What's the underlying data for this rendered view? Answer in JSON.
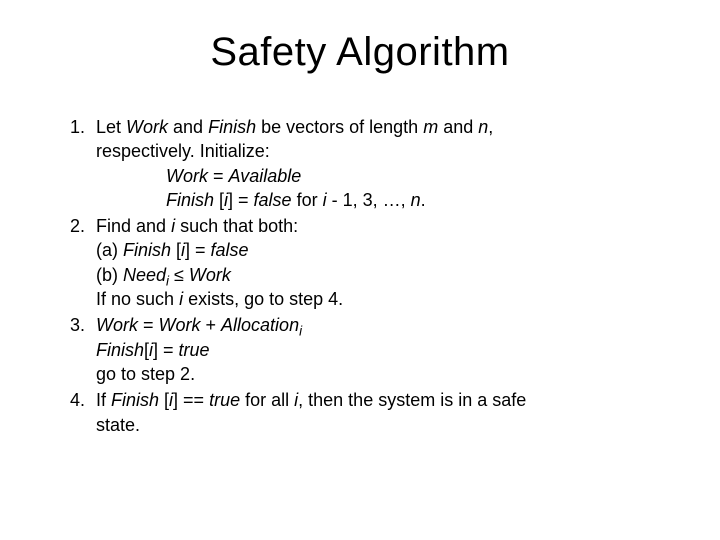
{
  "title": "Safety Algorithm",
  "s1": {
    "num": "1.",
    "l1a": "Let ",
    "work": "Work",
    "l1b": " and ",
    "finish": "Finish",
    "l1c": " be vectors of length ",
    "m": "m",
    "l1d": " and ",
    "n": "n",
    "l1e": ",",
    "l2": "respectively.  Initialize:",
    "l3a": "Work",
    "l3b": " = ",
    "l3c": "Available",
    "l4a": "Finish ",
    "l4b": "[",
    "l4i": "i",
    "l4c": "] = ",
    "l4false": "false",
    "l4d": " for ",
    "l4i2": "i ",
    "l4e": "- 1, 3, …, ",
    "l4n": "n",
    "l4f": "."
  },
  "s2": {
    "num": "2.",
    "l1a": "Find and ",
    "l1i": "i",
    "l1b": " such that both:",
    "l2a": "(a) ",
    "l2fin": "Finish ",
    "l2b": "[",
    "l2i": "i",
    "l2c": "] = ",
    "l2false": "false",
    "l3a": "(b) ",
    "l3need": "Need",
    "l3sub": "i",
    "l3b": " ≤ ",
    "l3work": "Work",
    "l4a": "If no such ",
    "l4i": "i",
    "l4b": " exists, go to step 4."
  },
  "s3": {
    "num": "3.",
    "l1a": "Work",
    "l1b": " = ",
    "l1c": "Work",
    "l1d": " + ",
    "l1e": "Allocation",
    "l1sub": "i",
    "l2a": "Finish",
    "l2b": "[",
    "l2i": "i",
    "l2c": "] = ",
    "l2true": "true",
    "l3": "go to step 2."
  },
  "s4": {
    "num": "4.",
    "l1a": "If ",
    "l1fin": "Finish ",
    "l1b": "[",
    "l1i": "i",
    "l1c": "] == ",
    "l1true": "true",
    "l1d": " for all ",
    "l1i2": "i",
    "l1e": ", then the system is in a safe",
    "l2": "state."
  }
}
